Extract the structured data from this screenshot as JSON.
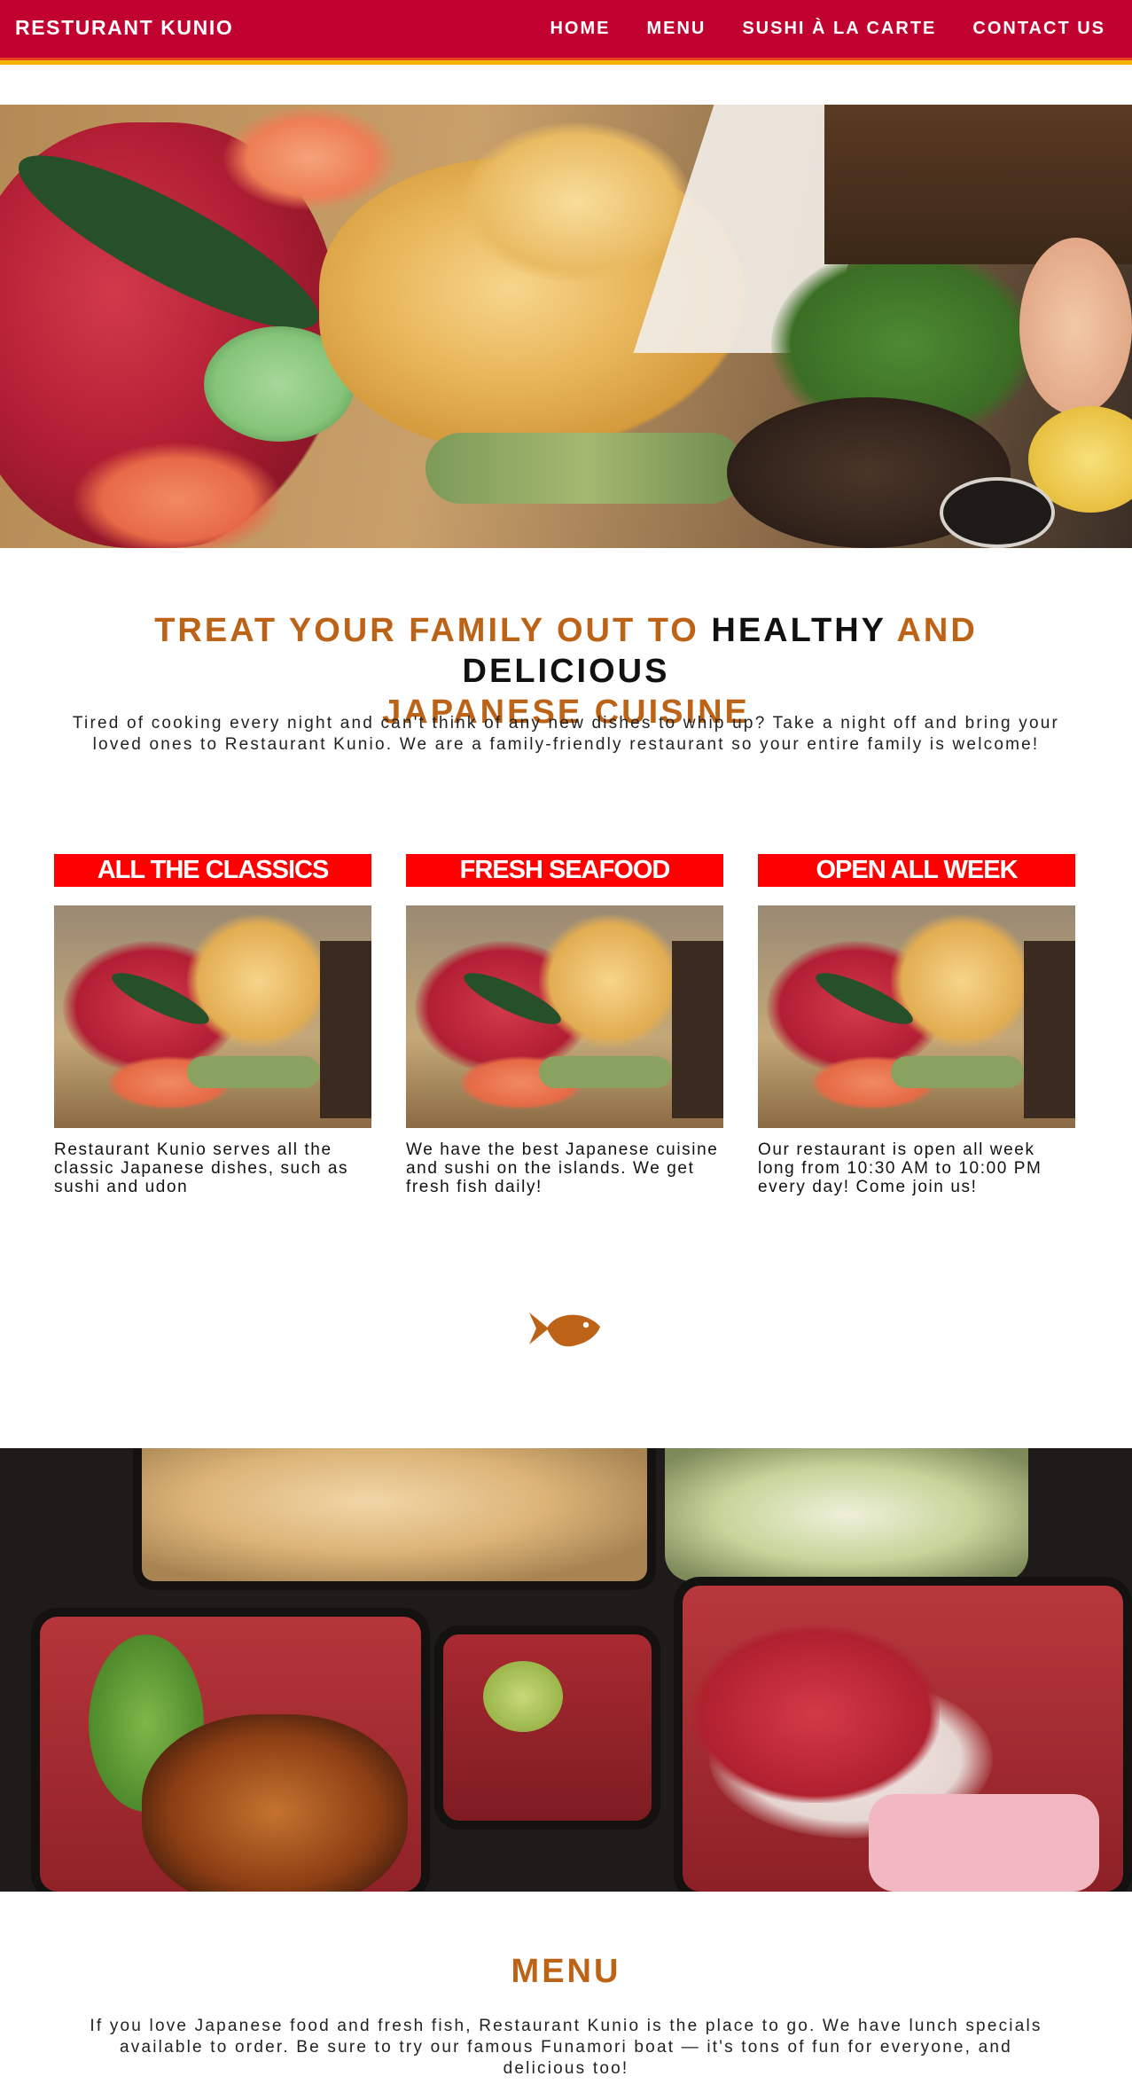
{
  "nav": {
    "brand": "RESTURANT KUNIO",
    "items": [
      "HOME",
      "MENU",
      "SUSHI À LA CARTE",
      "CONTACT US"
    ]
  },
  "intro": {
    "title_part1": "TREAT YOUR FAMILY OUT TO ",
    "title_part2": "HEALTHY",
    "title_part3": " AND ",
    "title_part4": "DELICIOUS",
    "title_part5": "JAPANESE CUISINE",
    "text": "Tired of cooking every night and can't think of any new dishes to whip up? Take a night off and bring your loved ones to Restaurant Kunio. We are a family-friendly restaurant so your entire family is welcome!"
  },
  "features": [
    {
      "title": "ALL THE CLASSICS",
      "text": "Restaurant Kunio serves all the classic Japanese dishes, such as sushi and udon"
    },
    {
      "title": "FRESH SEAFOOD",
      "text": "We have the best Japanese cuisine and sushi on the islands. We get fresh fish daily!"
    },
    {
      "title": "OPEN ALL WEEK",
      "text": "Our restaurant is open all week long from 10:30 AM to 10:00 PM every day! Come join us!"
    }
  ],
  "menu_section": {
    "title": "MENU",
    "text": "If you love Japanese food and fresh fish, Restaurant Kunio is the place to go. We have lunch specials available to order. Be sure to try our famous Funamori boat — it's tons of fun for everyone, and delicious too!"
  },
  "icons": {
    "divider": "fish-icon"
  },
  "colors": {
    "nav_bg": "#c10230",
    "nav_stripe": "#f5b300",
    "accent": "#bc6317",
    "feature_head": "#ff0000"
  }
}
